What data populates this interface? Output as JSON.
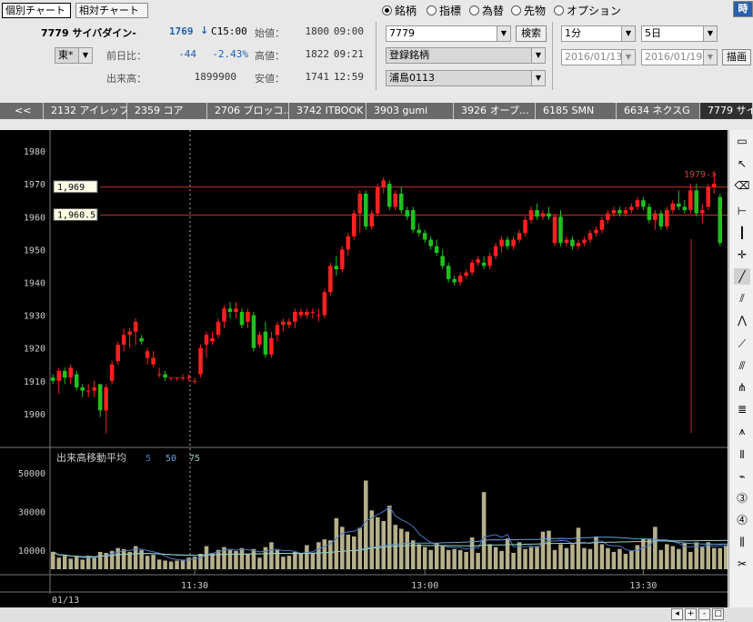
{
  "header": {
    "tab_individual": "個別チャート",
    "tab_relative": "相対チャート",
    "stock_code_name": "7779 サイバダイン-",
    "price": "1769",
    "arrow": "↓",
    "price_time": "C15:00",
    "exchange": "東*",
    "prev_change_label": "前日比：",
    "prev_change": "-44",
    "prev_change_pct": "-2.43%",
    "volume_label": "出来高：",
    "volume": "1899900",
    "open_label": "始値：",
    "open_value": "1800",
    "open_time": "09:00",
    "high_label": "高値：",
    "high_value": "1822",
    "high_time": "09:21",
    "low_label": "安値：",
    "low_value": "1741",
    "low_time": "12:59"
  },
  "radios": [
    {
      "label": "銘柄",
      "checked": true
    },
    {
      "label": "指標",
      "checked": false
    },
    {
      "label": "為替",
      "checked": false
    },
    {
      "label": "先物",
      "checked": false
    },
    {
      "label": "オプション",
      "checked": false
    }
  ],
  "time_button": "時",
  "search": {
    "code_value": "7779",
    "search_button": "検索",
    "registered_label": "登録銘柄",
    "list_value": "浦島0113"
  },
  "period": {
    "interval": "1分",
    "span": "5日",
    "date_from": "2016/01/13",
    "date_to": "2016/01/19",
    "draw_button": "描画"
  },
  "stock_tabs": [
    {
      "label": "<<"
    },
    {
      "label": "2132 アイレップ"
    },
    {
      "label": "2359 コア"
    },
    {
      "label": "2706 ブロッコ…"
    },
    {
      "label": "3742 ITBOOK"
    },
    {
      "label": "3903 gumi"
    },
    {
      "label": "3926 オープ…"
    },
    {
      "label": "6185 SMN"
    },
    {
      "label": "6634 ネクスG"
    },
    {
      "label": "7779 サイバ"
    }
  ],
  "chart_data": {
    "type": "candlestick",
    "price_axis": {
      "ticks": [
        1980,
        1970,
        1960,
        1950,
        1940,
        1930,
        1920,
        1910,
        1900
      ],
      "range": [
        1890,
        1985
      ]
    },
    "volume_axis": {
      "ticks": [
        50000,
        30000,
        10000
      ],
      "range": [
        0,
        58000
      ]
    },
    "time_ticks": [
      "11:30",
      "13:00",
      "13:30"
    ],
    "date_label": "01/13",
    "hlines": [
      {
        "label": "1,969",
        "value": 1969
      },
      {
        "label": "1,960.5",
        "value": 1960.5
      }
    ],
    "annotation": "1979->",
    "volume_legend": {
      "title": "出来高移動平均",
      "periods": [
        "5",
        "50",
        "75"
      ]
    },
    "candles": [
      [
        1911,
        1912,
        1909,
        1910
      ],
      [
        1910,
        1914,
        1906,
        1913
      ],
      [
        1913,
        1914,
        1909,
        1911
      ],
      [
        1911,
        1915,
        1909,
        1914
      ],
      [
        1912,
        1913,
        1907,
        1908
      ],
      [
        1908,
        1909,
        1905,
        1907
      ],
      [
        1907,
        1909,
        1905,
        1907
      ],
      [
        1907,
        1910,
        1905,
        1908
      ],
      [
        1909,
        1909,
        1899,
        1901
      ],
      [
        1901,
        1909,
        1894,
        1908
      ],
      [
        1910,
        1916,
        1909,
        1915
      ],
      [
        1916,
        1922,
        1915,
        1921
      ],
      [
        1921,
        1926,
        1919,
        1924
      ],
      [
        1924,
        1926,
        1920,
        1925
      ],
      [
        1925,
        1929,
        1921,
        1928
      ],
      [
        1923,
        1924,
        1921,
        1922
      ],
      [
        1917,
        1920,
        1915,
        1919
      ],
      [
        1915,
        1919,
        1914,
        1917
      ],
      [
        1912,
        1914,
        1911,
        1912
      ],
      [
        1912,
        1913,
        1910,
        1911
      ],
      [
        1911,
        1911,
        1910,
        1911
      ],
      [
        1911,
        1911,
        1910,
        1911
      ],
      [
        1911,
        1912,
        1910,
        1911
      ],
      [
        1911,
        1912,
        1910,
        1911
      ],
      [
        1910,
        1911,
        1909,
        1910
      ],
      [
        1912,
        1921,
        1911,
        1920
      ],
      [
        1921,
        1925,
        1917,
        1924
      ],
      [
        1922,
        1925,
        1921,
        1923
      ],
      [
        1924,
        1929,
        1923,
        1928
      ],
      [
        1928,
        1933,
        1926,
        1932
      ],
      [
        1932,
        1934,
        1929,
        1931
      ],
      [
        1931,
        1934,
        1929,
        1932
      ],
      [
        1931,
        1932,
        1926,
        1927
      ],
      [
        1928,
        1932,
        1926,
        1931
      ],
      [
        1930,
        1931,
        1919,
        1920
      ],
      [
        1921,
        1925,
        1920,
        1924
      ],
      [
        1925,
        1928,
        1917,
        1918
      ],
      [
        1918,
        1925,
        1917,
        1923
      ],
      [
        1924,
        1928,
        1922,
        1927
      ],
      [
        1927,
        1929,
        1925,
        1928
      ],
      [
        1927,
        1929,
        1926,
        1928
      ],
      [
        1928,
        1932,
        1926,
        1931
      ],
      [
        1930,
        1932,
        1929,
        1931
      ],
      [
        1930,
        1932,
        1929,
        1931
      ],
      [
        1931,
        1932,
        1929,
        1931
      ],
      [
        1930,
        1932,
        1928,
        1930
      ],
      [
        1930,
        1938,
        1929,
        1937
      ],
      [
        1937,
        1946,
        1936,
        1945
      ],
      [
        1945,
        1948,
        1942,
        1944
      ],
      [
        1944,
        1951,
        1943,
        1950
      ],
      [
        1950,
        1955,
        1948,
        1954
      ],
      [
        1954,
        1962,
        1953,
        1961
      ],
      [
        1961,
        1968,
        1955,
        1967
      ],
      [
        1967,
        1968,
        1956,
        1957
      ],
      [
        1957,
        1962,
        1956,
        1961
      ],
      [
        1961,
        1970,
        1960,
        1969
      ],
      [
        1969,
        1972,
        1967,
        1971
      ],
      [
        1970,
        1971,
        1962,
        1963
      ],
      [
        1963,
        1968,
        1962,
        1967
      ],
      [
        1967,
        1969,
        1961,
        1962
      ],
      [
        1962,
        1963,
        1959,
        1960
      ],
      [
        1962,
        1963,
        1955,
        1956
      ],
      [
        1956,
        1958,
        1954,
        1955
      ],
      [
        1955,
        1956,
        1952,
        1953
      ],
      [
        1953,
        1954,
        1950,
        1951
      ],
      [
        1951,
        1953,
        1948,
        1949
      ],
      [
        1948,
        1950,
        1944,
        1945
      ],
      [
        1945,
        1946,
        1940,
        1941
      ],
      [
        1941,
        1942,
        1939,
        1940
      ],
      [
        1940,
        1943,
        1939,
        1942
      ],
      [
        1942,
        1944,
        1941,
        1943
      ],
      [
        1943,
        1947,
        1942,
        1946
      ],
      [
        1946,
        1948,
        1945,
        1947
      ],
      [
        1946,
        1948,
        1944,
        1945
      ],
      [
        1945,
        1949,
        1944,
        1948
      ],
      [
        1948,
        1952,
        1947,
        1951
      ],
      [
        1951,
        1954,
        1949,
        1953
      ],
      [
        1953,
        1954,
        1950,
        1951
      ],
      [
        1951,
        1954,
        1950,
        1953
      ],
      [
        1953,
        1956,
        1952,
        1955
      ],
      [
        1955,
        1960,
        1954,
        1959
      ],
      [
        1959,
        1963,
        1958,
        1962
      ],
      [
        1962,
        1964,
        1959,
        1960
      ],
      [
        1960,
        1962,
        1959,
        1961
      ],
      [
        1961,
        1963,
        1959,
        1960
      ],
      [
        1952,
        1961,
        1951,
        1960
      ],
      [
        1960,
        1962,
        1951,
        1952
      ],
      [
        1952,
        1954,
        1951,
        1953
      ],
      [
        1953,
        1954,
        1950,
        1951
      ],
      [
        1951,
        1953,
        1950,
        1952
      ],
      [
        1952,
        1954,
        1951,
        1953
      ],
      [
        1953,
        1956,
        1952,
        1955
      ],
      [
        1955,
        1957,
        1954,
        1956
      ],
      [
        1956,
        1960,
        1955,
        1959
      ],
      [
        1959,
        1962,
        1958,
        1961
      ],
      [
        1961,
        1963,
        1960,
        1962
      ],
      [
        1962,
        1963,
        1960,
        1961
      ],
      [
        1961,
        1963,
        1960,
        1962
      ],
      [
        1962,
        1964,
        1961,
        1963
      ],
      [
        1963,
        1966,
        1962,
        1965
      ],
      [
        1965,
        1966,
        1962,
        1963
      ],
      [
        1963,
        1964,
        1958,
        1959
      ],
      [
        1959,
        1962,
        1956,
        1961
      ],
      [
        1961,
        1962,
        1956,
        1957
      ],
      [
        1957,
        1963,
        1956,
        1962
      ],
      [
        1962,
        1965,
        1961,
        1964
      ],
      [
        1964,
        1968,
        1962,
        1963
      ],
      [
        1963,
        1965,
        1961,
        1962
      ],
      [
        1962,
        1970,
        1961,
        1968
      ],
      [
        1968,
        1970,
        1960,
        1961
      ],
      [
        1961,
        1964,
        1958,
        1962
      ],
      [
        1963,
        1970,
        1962,
        1969
      ],
      [
        1969,
        1974,
        1967,
        1970
      ],
      [
        1966,
        1967,
        1951,
        1952
      ]
    ],
    "volumes": [
      9000,
      6000,
      7000,
      5500,
      6500,
      5000,
      7000,
      6000,
      9000,
      8500,
      9500,
      11000,
      10500,
      9000,
      12000,
      10000,
      7000,
      7500,
      5000,
      4500,
      4000,
      4500,
      5000,
      6000,
      6500,
      8000,
      12000,
      8500,
      10000,
      11500,
      10000,
      9500,
      11000,
      8000,
      10500,
      6000,
      11500,
      14000,
      10000,
      6500,
      7000,
      9000,
      8500,
      12500,
      8500,
      14000,
      15500,
      15000,
      26500,
      22000,
      18000,
      17000,
      21500,
      46000,
      30500,
      27000,
      25000,
      33000,
      23000,
      21000,
      19500,
      15000,
      13000,
      11500,
      10000,
      13500,
      12500,
      10000,
      10500,
      10000,
      9000,
      16500,
      8500,
      40000,
      13000,
      11500,
      9500,
      16000,
      8500,
      14000,
      10500,
      11500,
      12000,
      19500,
      20000,
      10000,
      13000,
      11000,
      13000,
      21500,
      11000,
      10500,
      17000,
      13000,
      11000,
      9000,
      10500,
      8000,
      9500,
      12500,
      16000,
      15500,
      22000,
      10000,
      13000,
      12000,
      10500,
      13500,
      9000,
      14000,
      11500,
      14000,
      11000,
      11000,
      12500,
      14500,
      30000
    ]
  }
}
